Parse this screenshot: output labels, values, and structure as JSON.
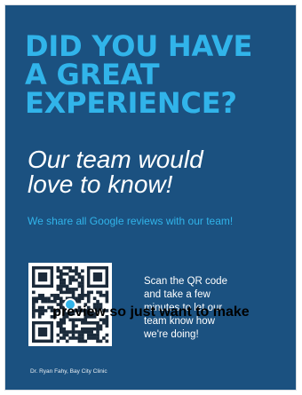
{
  "poster": {
    "headline_lines": [
      "DID YOU HAVE",
      "A GREAT",
      "EXPERIENCE?"
    ],
    "subhead_lines": [
      "Our team would",
      "love to know!"
    ],
    "share_text": "We share all Google reviews with our team!",
    "scan_lines": [
      "Scan the QR code",
      "and take a few",
      "minutes to let our",
      "team know how",
      "we're doing!"
    ],
    "footer": "Dr. Ryan Fahy, Bay City Clinic",
    "colors": {
      "background": "#1b5180",
      "accent": "#31b4ea",
      "text": "#ffffff"
    },
    "qr_icon": "qr-code-icon"
  },
  "overlay_text": "preview so just want to make"
}
